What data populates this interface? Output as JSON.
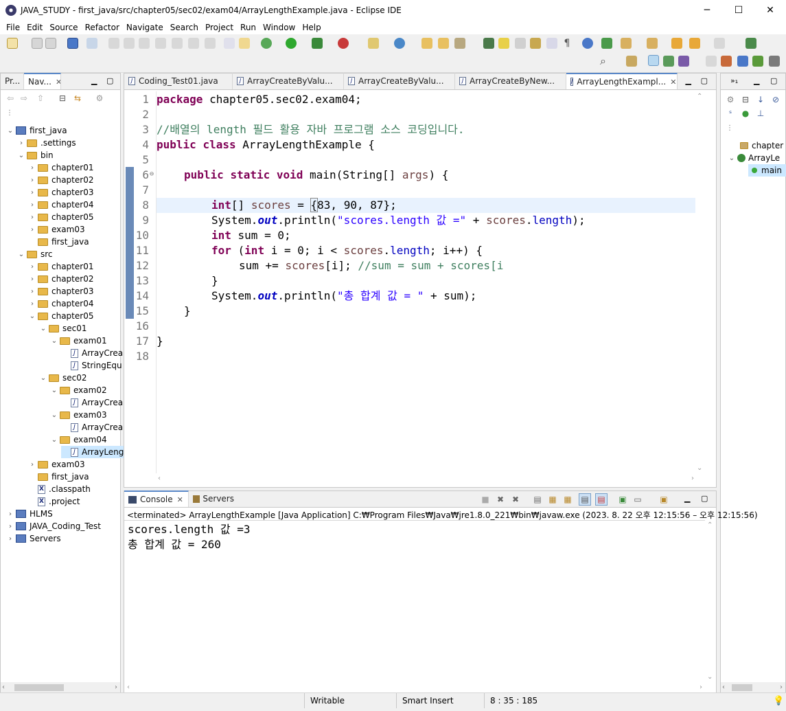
{
  "window": {
    "title": "JAVA_STUDY - first_java/src/chapter05/sec02/exam04/ArrayLengthExample.java - Eclipse IDE",
    "minimize": "─",
    "maximize": "☐",
    "close": "✕"
  },
  "menu": [
    "File",
    "Edit",
    "Source",
    "Refactor",
    "Navigate",
    "Search",
    "Project",
    "Run",
    "Window",
    "Help"
  ],
  "left_panel": {
    "tabs": [
      "Pr...",
      "Nav...",
      "✕"
    ],
    "tree": [
      {
        "label": "first_java",
        "level": 0,
        "twisty": "⌄",
        "type": "project"
      },
      {
        "label": ".settings",
        "level": 1,
        "twisty": "›",
        "type": "folder"
      },
      {
        "label": "bin",
        "level": 1,
        "twisty": "⌄",
        "type": "folder"
      },
      {
        "label": "chapter01",
        "level": 2,
        "twisty": "›",
        "type": "folder"
      },
      {
        "label": "chapter02",
        "level": 2,
        "twisty": "›",
        "type": "folder"
      },
      {
        "label": "chapter03",
        "level": 2,
        "twisty": "›",
        "type": "folder"
      },
      {
        "label": "chapter04",
        "level": 2,
        "twisty": "›",
        "type": "folder"
      },
      {
        "label": "chapter05",
        "level": 2,
        "twisty": "›",
        "type": "folder"
      },
      {
        "label": "exam03",
        "level": 2,
        "twisty": "›",
        "type": "folder"
      },
      {
        "label": "first_java",
        "level": 2,
        "twisty": "",
        "type": "folder"
      },
      {
        "label": "src",
        "level": 1,
        "twisty": "⌄",
        "type": "folder"
      },
      {
        "label": "chapter01",
        "level": 2,
        "twisty": "›",
        "type": "folder"
      },
      {
        "label": "chapter02",
        "level": 2,
        "twisty": "›",
        "type": "folder"
      },
      {
        "label": "chapter03",
        "level": 2,
        "twisty": "›",
        "type": "folder"
      },
      {
        "label": "chapter04",
        "level": 2,
        "twisty": "›",
        "type": "folder"
      },
      {
        "label": "chapter05",
        "level": 2,
        "twisty": "⌄",
        "type": "folder"
      },
      {
        "label": "sec01",
        "level": 3,
        "twisty": "⌄",
        "type": "folder"
      },
      {
        "label": "exam01",
        "level": 4,
        "twisty": "⌄",
        "type": "folder"
      },
      {
        "label": "ArrayCrea",
        "level": 5,
        "twisty": "",
        "type": "java"
      },
      {
        "label": "StringEqu",
        "level": 5,
        "twisty": "",
        "type": "java"
      },
      {
        "label": "sec02",
        "level": 3,
        "twisty": "⌄",
        "type": "folder"
      },
      {
        "label": "exam02",
        "level": 4,
        "twisty": "⌄",
        "type": "folder"
      },
      {
        "label": "ArrayCrea",
        "level": 5,
        "twisty": "",
        "type": "java"
      },
      {
        "label": "exam03",
        "level": 4,
        "twisty": "⌄",
        "type": "folder"
      },
      {
        "label": "ArrayCrea",
        "level": 5,
        "twisty": "",
        "type": "java"
      },
      {
        "label": "exam04",
        "level": 4,
        "twisty": "⌄",
        "type": "folder"
      },
      {
        "label": "ArrayLeng",
        "level": 5,
        "twisty": "",
        "type": "java",
        "selected": true
      },
      {
        "label": "exam03",
        "level": 2,
        "twisty": "›",
        "type": "folder"
      },
      {
        "label": "first_java",
        "level": 2,
        "twisty": "",
        "type": "folder"
      },
      {
        "label": ".classpath",
        "level": 2,
        "twisty": "",
        "type": "xml"
      },
      {
        "label": ".project",
        "level": 2,
        "twisty": "",
        "type": "xml"
      },
      {
        "label": "HLMS",
        "level": 0,
        "twisty": "›",
        "type": "project"
      },
      {
        "label": "JAVA_Coding_Test",
        "level": 0,
        "twisty": "›",
        "type": "project"
      },
      {
        "label": "Servers",
        "level": 0,
        "twisty": "›",
        "type": "project"
      }
    ]
  },
  "editor": {
    "tabs": [
      {
        "label": "Coding_Test01.java",
        "active": false
      },
      {
        "label": "ArrayCreateByValu...",
        "active": false
      },
      {
        "label": "ArrayCreateByValu...",
        "active": false
      },
      {
        "label": "ArrayCreateByNew...",
        "active": false
      },
      {
        "label": "ArrayLengthExampl...",
        "active": true
      }
    ],
    "line_numbers": [
      "1",
      "2",
      "3",
      "4",
      "5",
      "6",
      "7",
      "8",
      "9",
      "10",
      "11",
      "12",
      "13",
      "14",
      "15",
      "16",
      "17",
      "18"
    ],
    "fold_marker": "⊖",
    "lines": {
      "l1": {
        "kw": "package",
        "rest": " chapter05.sec02.exam04;"
      },
      "l3": {
        "comment": "//배열의 length 필드 활용 자바 프로그램 소스 코딩입니다."
      },
      "l4": {
        "kw1": "public",
        "kw2": "class",
        "rest": " ArrayLengthExample {"
      },
      "l6": {
        "kw1": "public",
        "kw2": "static",
        "kw3": "void",
        "rest1": " main(String[] ",
        "param": "args",
        "rest2": ") {"
      },
      "l8": {
        "kw": "int",
        "rest1": "[] ",
        "var": "scores",
        "rest2": " = ",
        "brace": "{",
        "rest3": "83, 90, 87};"
      },
      "l9": {
        "a": "System.",
        "out": "out",
        "b": ".println(",
        "str": "\"scores.length 값 =\"",
        "c": " + ",
        "fld": "scores",
        "d": ".",
        "len": "length",
        "e": ");"
      },
      "l10": {
        "kw": "int",
        "rest": " sum = 0;"
      },
      "l11": {
        "kw1": "for",
        "a": " (",
        "kw2": "int",
        "b": " i = 0; i < ",
        "fld": "scores",
        "c": ".",
        "len": "length",
        "d": "; i++) {"
      },
      "l12": {
        "a": "sum += ",
        "fld": "scores",
        "b": "[i]; ",
        "com": "//sum = sum + scores[i"
      },
      "l13": {
        "a": "}"
      },
      "l14": {
        "a": "System.",
        "out": "out",
        "b": ".println(",
        "str": "\"총 합계 값 = \"",
        "c": " + sum);"
      },
      "l15": {
        "a": "}"
      },
      "l17": {
        "a": "}"
      }
    }
  },
  "outline": {
    "items": [
      {
        "label": "chapter",
        "level": 1
      },
      {
        "label": "ArrayLe",
        "level": 1
      },
      {
        "label": "main",
        "level": 2
      }
    ]
  },
  "console": {
    "tabs": [
      {
        "label": "Console",
        "active": true
      },
      {
        "label": "Servers",
        "active": false
      }
    ],
    "status_line": "<terminated> ArrayLengthExample [Java Application] C:₩Program Files₩Java₩jre1.8.0_221₩bin₩javaw.exe  (2023. 8. 22 오후 12:15:56 – 오후 12:15:56)",
    "output": [
      "scores.length 값 =3",
      "총 합계 값 = 260"
    ]
  },
  "statusbar": {
    "writable": "Writable",
    "insert_mode": "Smart Insert",
    "position": "8 : 35 : 185"
  },
  "colors": {
    "keyword": "#7f0055",
    "string": "#2a00ff",
    "comment": "#3f7f5f",
    "field": "#0000c0",
    "current_line": "#e8f2fe",
    "selection": "#cce8ff"
  }
}
